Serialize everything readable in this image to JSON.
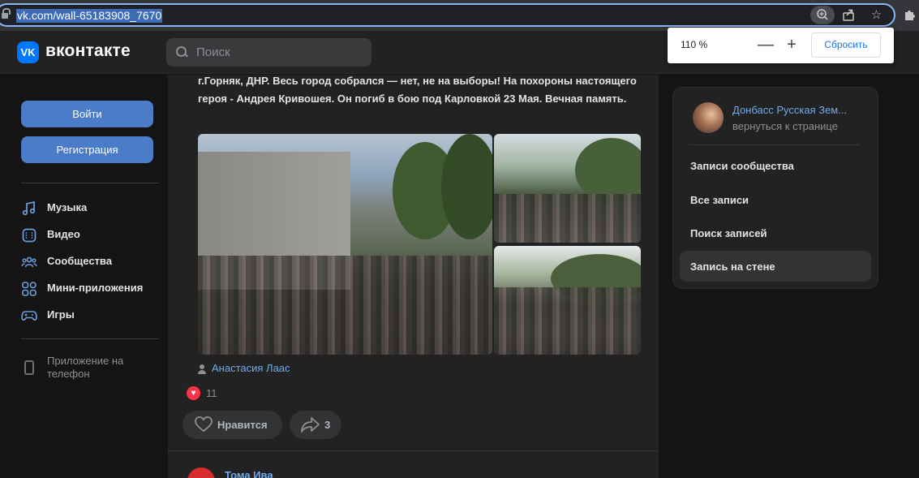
{
  "browser": {
    "url": "vk.com/wall-65183908_7670",
    "zoom": {
      "value": "110 %",
      "minus": "—",
      "plus": "+",
      "reset_label": "Сбросить"
    }
  },
  "header": {
    "logo_mark": "VK",
    "logo_text": "вконтакте",
    "search_placeholder": "Поиск"
  },
  "sidebar": {
    "login_label": "Войти",
    "register_label": "Регистрация",
    "items": [
      {
        "label": "Музыка",
        "icon": "music-icon"
      },
      {
        "label": "Видео",
        "icon": "video-icon"
      },
      {
        "label": "Сообщества",
        "icon": "communities-icon"
      },
      {
        "label": "Мини-приложения",
        "icon": "mini-apps-icon"
      },
      {
        "label": "Игры",
        "icon": "games-icon"
      }
    ],
    "app_label": "Приложение на телефон"
  },
  "post": {
    "text": "г.Горняк, ДНР. Весь город собрался — нет, не на выборы! На похороны настоящего героя - Андрея Кривошея. Он погиб в бою под Карловкой 23 Мая. Вечная память.",
    "author": "Анастасия Лаас",
    "reaction_count": "11",
    "like_label": "Нравится",
    "share_count": "3"
  },
  "next_post": {
    "author": "Тома Ива"
  },
  "right_panel": {
    "group_name": "Донбасс Русская Зем...",
    "back_label": "вернуться к странице",
    "menu": [
      {
        "label": "Записи сообщества",
        "active": false
      },
      {
        "label": "Все записи",
        "active": false
      },
      {
        "label": "Поиск записей",
        "active": false
      },
      {
        "label": "Запись на стене",
        "active": true
      }
    ]
  },
  "colors": {
    "accent": "#71aaeb",
    "button": "#4a7cc7",
    "background": "#141414",
    "surface": "#222222",
    "heart": "#ff3347"
  }
}
